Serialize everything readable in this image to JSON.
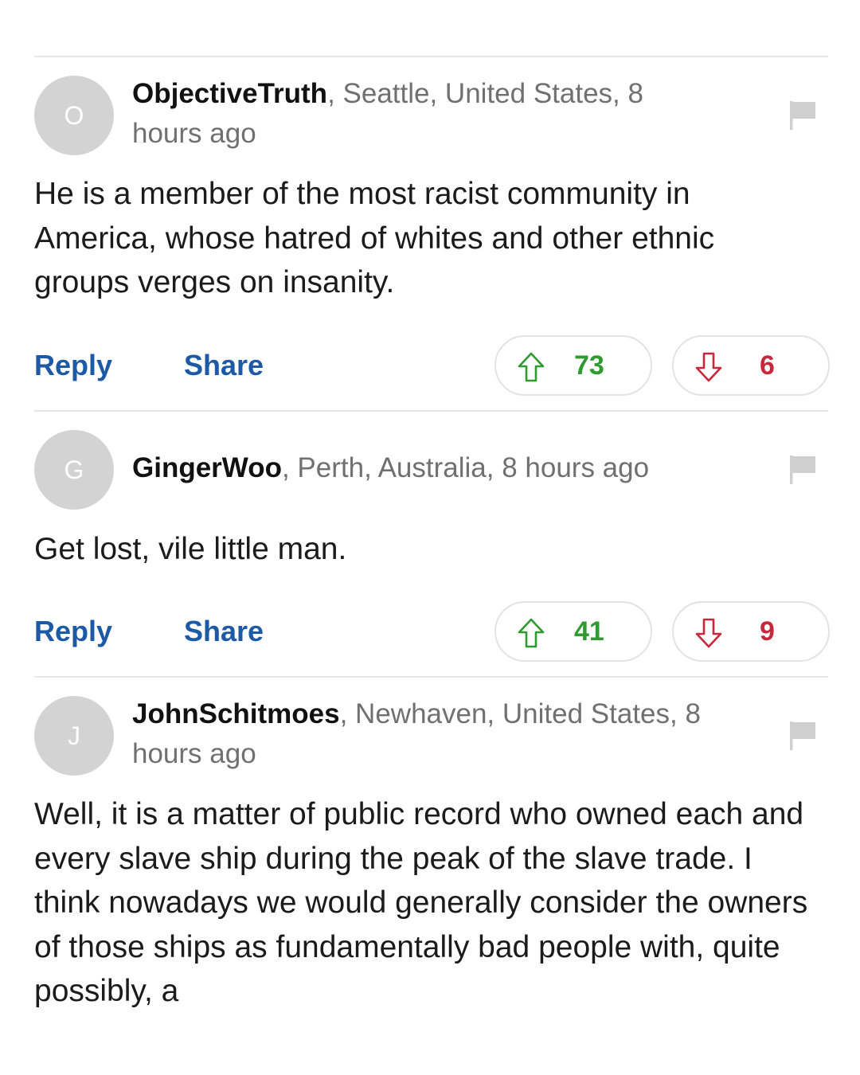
{
  "comments": [
    {
      "avatar_letter": "O",
      "username": "ObjectiveTruth",
      "meta": ", Seattle, United States, 8 hours ago",
      "body": "He is a member of the most racist community in America, whose hatred of whites and other ethnic groups verges on insanity.",
      "reply_label": "Reply",
      "share_label": "Share",
      "upvotes": "73",
      "downvotes": "6"
    },
    {
      "avatar_letter": "G",
      "username": "GingerWoo",
      "meta": ", Perth, Australia, 8 hours ago",
      "body": "Get lost, vile little man.",
      "reply_label": "Reply",
      "share_label": "Share",
      "upvotes": "41",
      "downvotes": "9"
    },
    {
      "avatar_letter": "J",
      "username": "JohnSchitmoes",
      "meta": ", Newhaven, United States, 8 hours ago",
      "body": "Well, it is a matter of public record who owned each and every slave ship during the peak of the slave trade. I think nowadays we would generally consider the owners of those ships as fundamentally bad people with, quite possibly, a"
    }
  ],
  "icons": {
    "avatar": "avatar-icon",
    "flag": "flag-icon",
    "upvote": "arrow-up-icon",
    "downvote": "arrow-down-icon"
  },
  "colors": {
    "link": "#1d5aa6",
    "upvote": "#2f9a2f",
    "downvote": "#c8283c",
    "avatar_bg": "#d3d3d3",
    "divider": "#e6e6e6"
  }
}
